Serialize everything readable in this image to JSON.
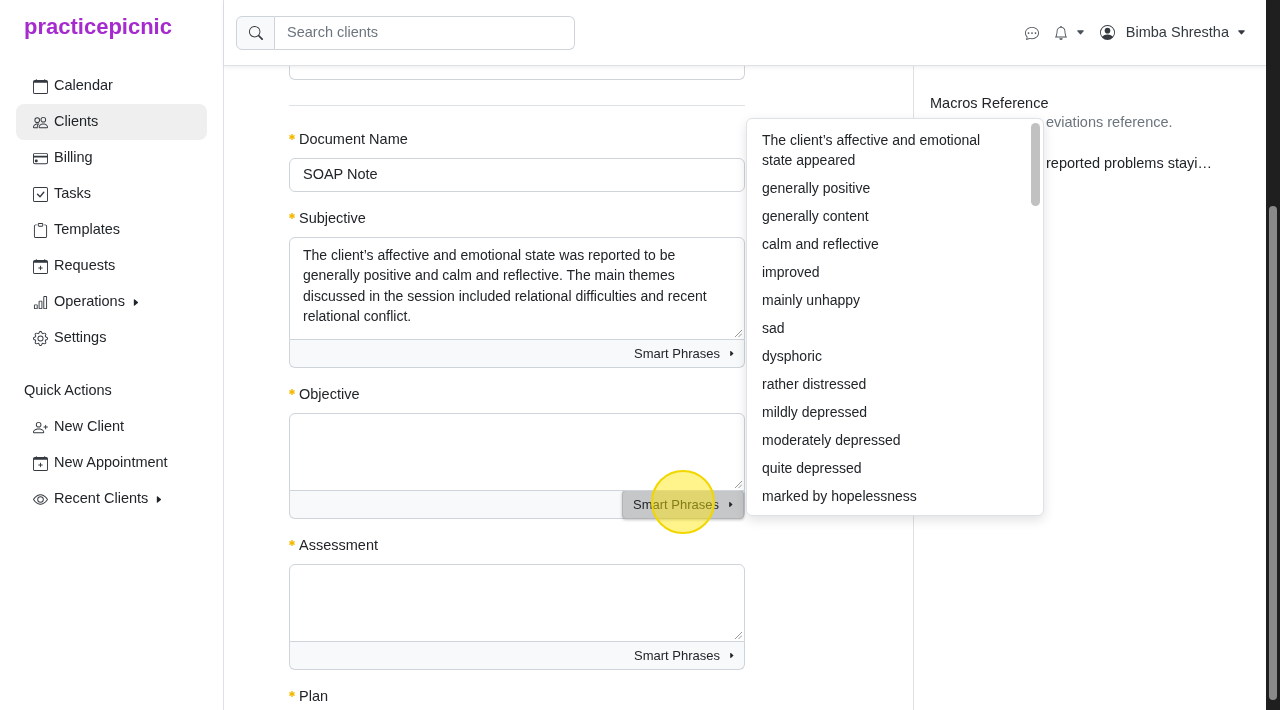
{
  "sidebar": {
    "logo": "practicepicnic",
    "nav": [
      {
        "label": "Calendar",
        "selected": false,
        "submenu": false
      },
      {
        "label": "Clients",
        "selected": true,
        "submenu": false
      },
      {
        "label": "Billing",
        "selected": false,
        "submenu": false
      },
      {
        "label": "Tasks",
        "selected": false,
        "submenu": false
      },
      {
        "label": "Templates",
        "selected": false,
        "submenu": false
      },
      {
        "label": "Requests",
        "selected": false,
        "submenu": false
      },
      {
        "label": "Operations",
        "selected": false,
        "submenu": true
      },
      {
        "label": "Settings",
        "selected": false,
        "submenu": false
      }
    ],
    "quick_actions": {
      "title": "Quick Actions",
      "items": [
        {
          "label": "New Client",
          "submenu": false
        },
        {
          "label": "New Appointment",
          "submenu": false
        },
        {
          "label": "Recent Clients",
          "submenu": true
        }
      ]
    }
  },
  "header": {
    "search": {
      "placeholder": "Search clients"
    },
    "user": {
      "name": "Bimba Shrestha"
    }
  },
  "form": {
    "fields": [
      {
        "kind": "input",
        "label": "Document Name",
        "required": true,
        "value": "SOAP Note"
      },
      {
        "kind": "textarea",
        "label": "Subjective",
        "required": true,
        "value": "The client’s affective and emotional state was reported to be generally positive and calm and reflective. The main themes discussed in the session included relational difficulties and recent relational conflict.",
        "smart_phrases": {
          "label": "Smart Phrases",
          "active": false
        }
      },
      {
        "kind": "textarea",
        "label": "Objective",
        "required": true,
        "smart_phrases": {
          "label": "Smart Phrases",
          "active": true
        }
      },
      {
        "kind": "textarea",
        "label": "Assessment",
        "required": true,
        "smart_phrases": {
          "label": "Smart Phrases",
          "active": false
        }
      },
      {
        "kind": "label",
        "label": "Plan",
        "required": true
      }
    ]
  },
  "smart_phrases_menu": {
    "items": [
      "The client’s affective and emotional state appeared",
      "generally positive",
      "generally content",
      "calm and reflective",
      "improved",
      "mainly unhappy",
      "sad",
      "dysphoric",
      "rather distressed",
      "mildly depressed",
      "moderately depressed",
      "quite depressed",
      "marked by hopelessness"
    ]
  },
  "macros_panel": {
    "title": "Macros Reference",
    "lines": [
      {
        "kind": "description",
        "text": "eviations reference."
      },
      {
        "kind": "macro",
        "text": "reported problems stayi…"
      }
    ]
  }
}
